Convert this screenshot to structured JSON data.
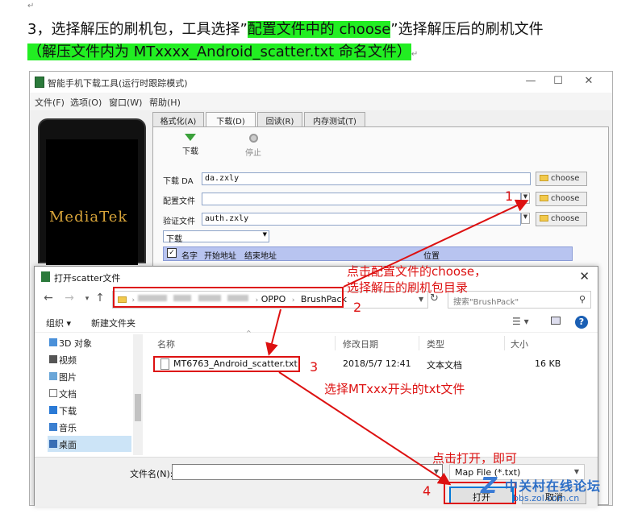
{
  "doc": {
    "line1_pre": "3，选择解压的刷机包，工具选择”",
    "line1_hl": "配置文件中的 choose",
    "line1_post": "”选择解压后的刷机文件",
    "line2_hl": "（解压文件内为 MTxxxx_Android_scatter.txt 命名文件）",
    "para_mark": "↵"
  },
  "app": {
    "title": "智能手机下载工具(运行时跟踪模式)",
    "menu": [
      "文件(F)",
      "选项(O)",
      "窗口(W)",
      "帮助(H)"
    ],
    "brand": "MediaTek",
    "tabs": [
      "格式化(A)",
      "下载(D)",
      "回读(R)",
      "内存测试(T)"
    ],
    "toolbar": {
      "download": "下载",
      "stop": "停止"
    },
    "fields": {
      "da_label": "下载 DA",
      "da_value": "da.zxly",
      "config_label": "配置文件",
      "config_value": "",
      "auth_label": "验证文件",
      "auth_value": "auth.zxly",
      "choose": "choose"
    },
    "mode_select": "下载",
    "grid_headers": [
      "名字",
      "开始地址",
      "结束地址",
      "位置"
    ]
  },
  "dialog": {
    "title": "打开scatter文件",
    "path_tail_1": "OPPO",
    "path_tail_2": "BrushPack",
    "search_placeholder": "搜索\"BrushPack\"",
    "organize": "组织 ▾",
    "new_folder": "新建文件夹",
    "sidebar": [
      "3D 对象",
      "视频",
      "图片",
      "文档",
      "下载",
      "音乐",
      "桌面"
    ],
    "columns": [
      "名称",
      "修改日期",
      "类型",
      "大小"
    ],
    "file": {
      "name": "MT6763_Android_scatter.txt",
      "date": "2018/5/7 12:41",
      "type": "文本文档",
      "size": "16 KB"
    },
    "filename_label": "文件名(N):",
    "filetype": "Map File (*.txt)",
    "open": "打开",
    "cancel": "取消"
  },
  "annotations": {
    "a1": "点击配置文件的choose，",
    "a1b": "选择解压的刷机包目录",
    "a3": "选择MTxxx开头的txt文件",
    "a4": "点击打开，即可",
    "n1": "1",
    "n2": "2",
    "n3": "3",
    "n4": "4"
  },
  "watermark": {
    "line1": "中关村在线论坛",
    "line2": "bbs.zol.com.cn"
  }
}
